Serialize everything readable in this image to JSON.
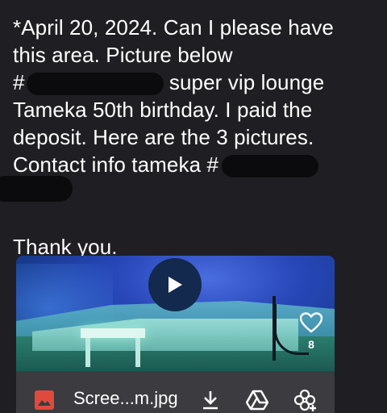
{
  "message": {
    "line1": "*April 20, 2024. Can I please have",
    "line2": "this area. Picture below",
    "line3_prefix": "#",
    "line3_suffix": "super vip lounge",
    "line4": "Tameka 50th birthday. I paid the",
    "line5": "deposit.  Here are the 3 pictures.",
    "line6": "Contact info tameka #",
    "line8": "Thank you."
  },
  "attachment": {
    "file_name": "Scree...m.jpg",
    "like_count": "8",
    "icons": {
      "play": "play-icon",
      "heart": "heart-icon",
      "file_type": "image-file-icon",
      "download": "download-icon",
      "drive": "google-drive-icon",
      "add_to_photos": "add-to-photos-icon"
    }
  },
  "colors": {
    "background": "#1f1f23",
    "file_bar": "#3b3b40",
    "image_file_icon": "#e04a3c"
  }
}
